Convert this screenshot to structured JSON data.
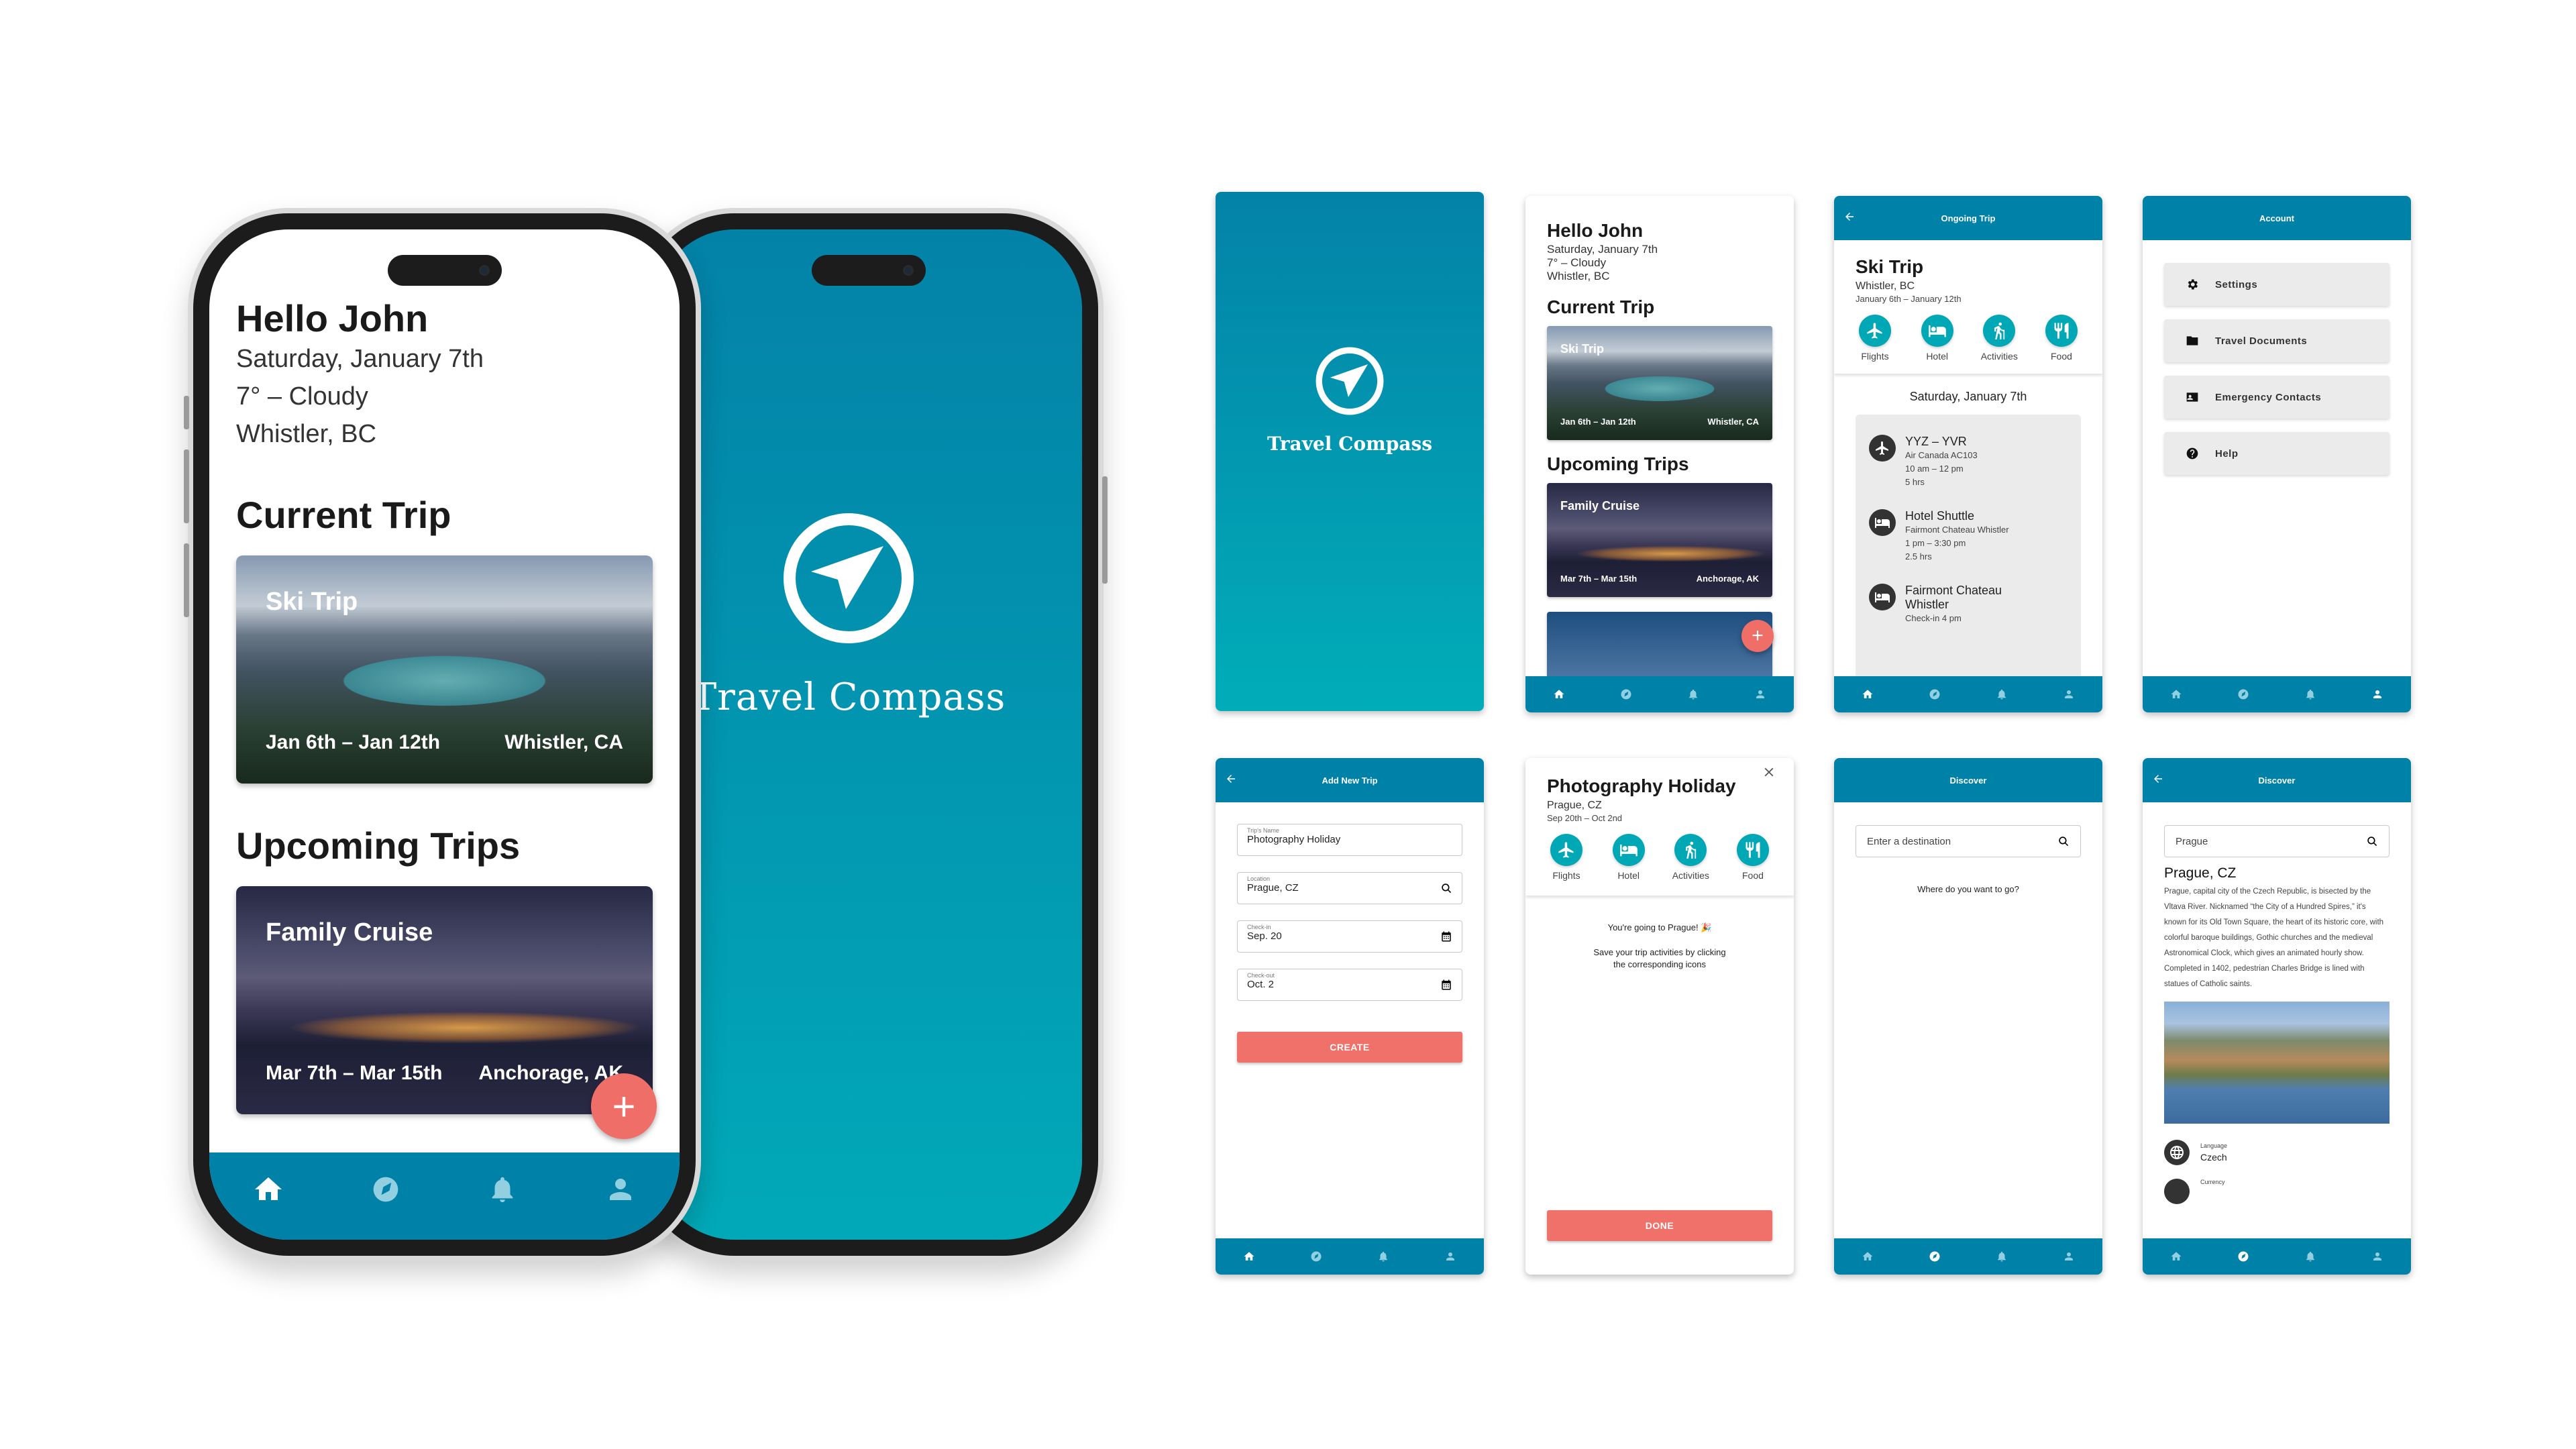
{
  "app": {
    "name": "Travel Compass",
    "colors": {
      "primary": "#0081a7",
      "accent": "#00a8b5",
      "coral": "#ef716a",
      "nav_inactive": "#92cfe0",
      "nav_active": "#ffffff"
    }
  },
  "nav": {
    "items": [
      {
        "icon": "home-icon",
        "label": "Home"
      },
      {
        "icon": "compass-icon",
        "label": "Discover"
      },
      {
        "icon": "bell-icon",
        "label": "Notifications"
      },
      {
        "icon": "person-icon",
        "label": "Account"
      }
    ]
  },
  "home": {
    "greeting": "Hello John",
    "date": "Saturday, January 7th",
    "weather": "7° – Cloudy",
    "location": "Whistler, BC",
    "current_trip_heading": "Current Trip",
    "upcoming_heading": "Upcoming Trips",
    "current_trip": {
      "title": "Ski Trip",
      "dates": "Jan 6th – Jan 12th",
      "location": "Whistler, CA"
    },
    "upcoming_trips": [
      {
        "title": "Family Cruise",
        "dates": "Mar 7th – Mar 15th",
        "location": "Anchorage, AK"
      }
    ],
    "fab_label": "+"
  },
  "ongoing": {
    "appbar_title": "Ongoing Trip",
    "title": "Ski Trip",
    "location": "Whistler, BC",
    "dates": "January 6th – January 12th",
    "categories": [
      "Flights",
      "Hotel",
      "Activities",
      "Food"
    ],
    "day_heading": "Saturday, January 7th",
    "events": [
      {
        "icon": "airplane-icon",
        "title": "YYZ – YVR",
        "lines": [
          "Air Canada AC103",
          "10 am – 12 pm",
          "5 hrs"
        ]
      },
      {
        "icon": "bed-icon",
        "title": "Hotel Shuttle",
        "lines": [
          "Fairmont Chateau Whistler",
          "1 pm – 3:30 pm",
          "2.5 hrs"
        ]
      },
      {
        "icon": "bed-icon",
        "title": "Fairmont Chateau Whistler",
        "lines": [
          "Check-in 4 pm"
        ]
      }
    ]
  },
  "account": {
    "appbar_title": "Account",
    "items": [
      {
        "icon": "gear-icon",
        "label": "Settings"
      },
      {
        "icon": "folder-icon",
        "label": "Travel Documents"
      },
      {
        "icon": "contact-card-icon",
        "label": "Emergency Contacts"
      },
      {
        "icon": "help-icon",
        "label": "Help"
      }
    ]
  },
  "add_trip": {
    "appbar_title": "Add New Trip",
    "fields": [
      {
        "label": "Trip's Name",
        "value": "Photography Holiday",
        "icon": ""
      },
      {
        "label": "Location",
        "value": "Prague, CZ",
        "icon": "search-icon"
      },
      {
        "label": "Check-in",
        "value": "Sep. 20",
        "icon": "calendar-icon"
      },
      {
        "label": "Check-out",
        "value": "Oct. 2",
        "icon": "calendar-icon"
      }
    ],
    "create_label": "CREATE"
  },
  "new_trip": {
    "title": "Photography Holiday",
    "location": "Prague, CZ",
    "dates": "Sep 20th – Oct 2nd",
    "categories": [
      "Flights",
      "Hotel",
      "Activities",
      "Food"
    ],
    "message": "You're going to Prague! 🎉",
    "hint": "Save your trip activities by clicking the corresponding icons",
    "done_label": "DONE"
  },
  "discover": {
    "appbar_title": "Discover",
    "search_placeholder": "Enter a destination",
    "prompt": "Where do you want to go?"
  },
  "discover_result": {
    "appbar_title": "Discover",
    "search_value": "Prague",
    "title": "Prague, CZ",
    "description": "Prague, capital city of the Czech Republic, is bisected by the Vltava River. Nicknamed “the City of a Hundred Spires,” it's known for its Old Town Square, the heart of its historic core, with colorful baroque buildings, Gothic churches and the medieval Astronomical Clock, which gives an animated hourly show. Completed in 1402, pedestrian Charles Bridge is lined with statues of Catholic saints.",
    "facts": [
      {
        "icon": "globe-icon",
        "label": "Language",
        "value": "Czech"
      },
      {
        "icon": "currency-icon",
        "label": "Currency",
        "value": ""
      }
    ]
  }
}
